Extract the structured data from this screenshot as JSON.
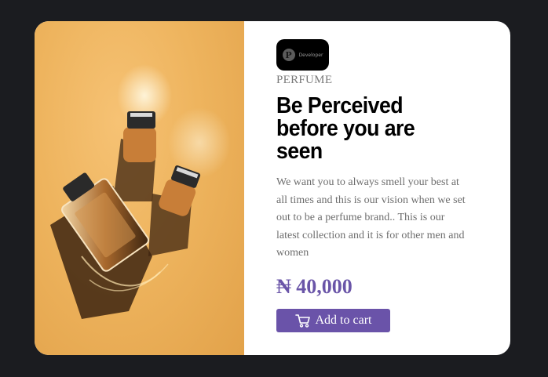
{
  "brand": {
    "logo_letter": "P",
    "logo_name": "Developer"
  },
  "product": {
    "category": "PERFUME",
    "title": "Be Perceived before you are seen",
    "description": "We want you to always smell your best at all times and this is our vision when we set out to be a perfume brand.. This is our latest collection and it is for other men and women",
    "price": "₦ 40,000",
    "image_name": "perfume-bottles-photo"
  },
  "actions": {
    "add_to_cart_label": "Add to cart",
    "cart_icon": "cart-icon"
  },
  "colors": {
    "accent": "#6a53a9",
    "page_bg": "#1b1c20",
    "card_bg": "#ffffff",
    "photo_bg": "#eeb45e"
  }
}
